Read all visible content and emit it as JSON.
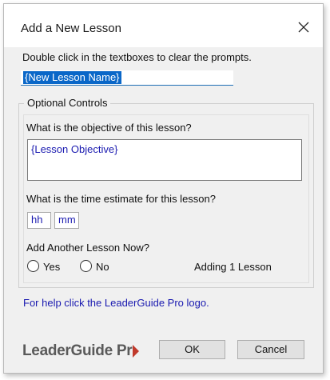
{
  "dialog": {
    "title": "Add a New Lesson",
    "instructions": "Double click in the textboxes to clear the prompts.",
    "lesson_name_value": "{New Lesson Name}",
    "group_label": "Optional Controls",
    "objective_question": "What is the objective of this lesson?",
    "objective_value": "{Lesson Objective}",
    "time_question": "What is the time estimate for this lesson?",
    "hours_value": "hh",
    "minutes_value": "mm",
    "add_another_question": "Add Another Lesson Now?",
    "yes_label": "Yes",
    "no_label": "No",
    "adding_status": "Adding 1 Lesson",
    "help_text": "For help click the LeaderGuide Pro logo.",
    "logo_text": "LeaderGuide Pr",
    "ok_label": "OK",
    "cancel_label": "Cancel"
  },
  "icons": {
    "close": "close-icon",
    "logo_mark": "play-arrow-icon"
  },
  "colors": {
    "accent": "#0a67c8",
    "prompt_text": "#1a1ab0",
    "logo_red": "#c0392b"
  }
}
